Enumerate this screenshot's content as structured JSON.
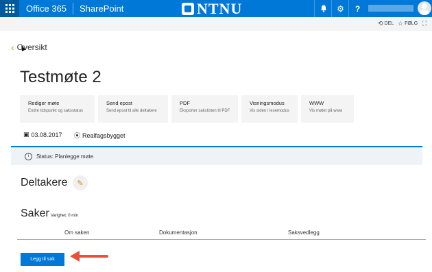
{
  "suitebar": {
    "app_name": "Office 365",
    "site_type": "SharePoint",
    "logo_text": "NTNU",
    "help_label": "?"
  },
  "commands": {
    "share_label": "DEL",
    "follow_label": "FØLG"
  },
  "nav": {
    "back_label": "Oversikt"
  },
  "meeting": {
    "title": "Testmøte 2",
    "date": "03.08.2017",
    "location": "Realfagsbygget",
    "status": "Status: Planlegge møte"
  },
  "actions": [
    {
      "title": "Rediger møte",
      "subtitle": "Endre tidspunkt og saksstatus"
    },
    {
      "title": "Send epost",
      "subtitle": "Send epost til alle deltakere"
    },
    {
      "title": "PDF",
      "subtitle": "Eksporter sakslisten til PDF"
    },
    {
      "title": "Visningsmodus",
      "subtitle": "Vis siden i lesemodus"
    },
    {
      "title": "WWW",
      "subtitle": "Vis møtet på www"
    }
  ],
  "participants": {
    "heading": "Deltakere"
  },
  "agenda": {
    "heading": "Saker",
    "duration": "Varighet: 0 min",
    "columns": [
      "Om saken",
      "Dokumentasjon",
      "Saksvedlegg"
    ],
    "add_button": "Legg til sak"
  },
  "colors": {
    "suitebar": "#0078d7",
    "accent": "#e08a00",
    "annotation_arrow": "#e8503a"
  }
}
